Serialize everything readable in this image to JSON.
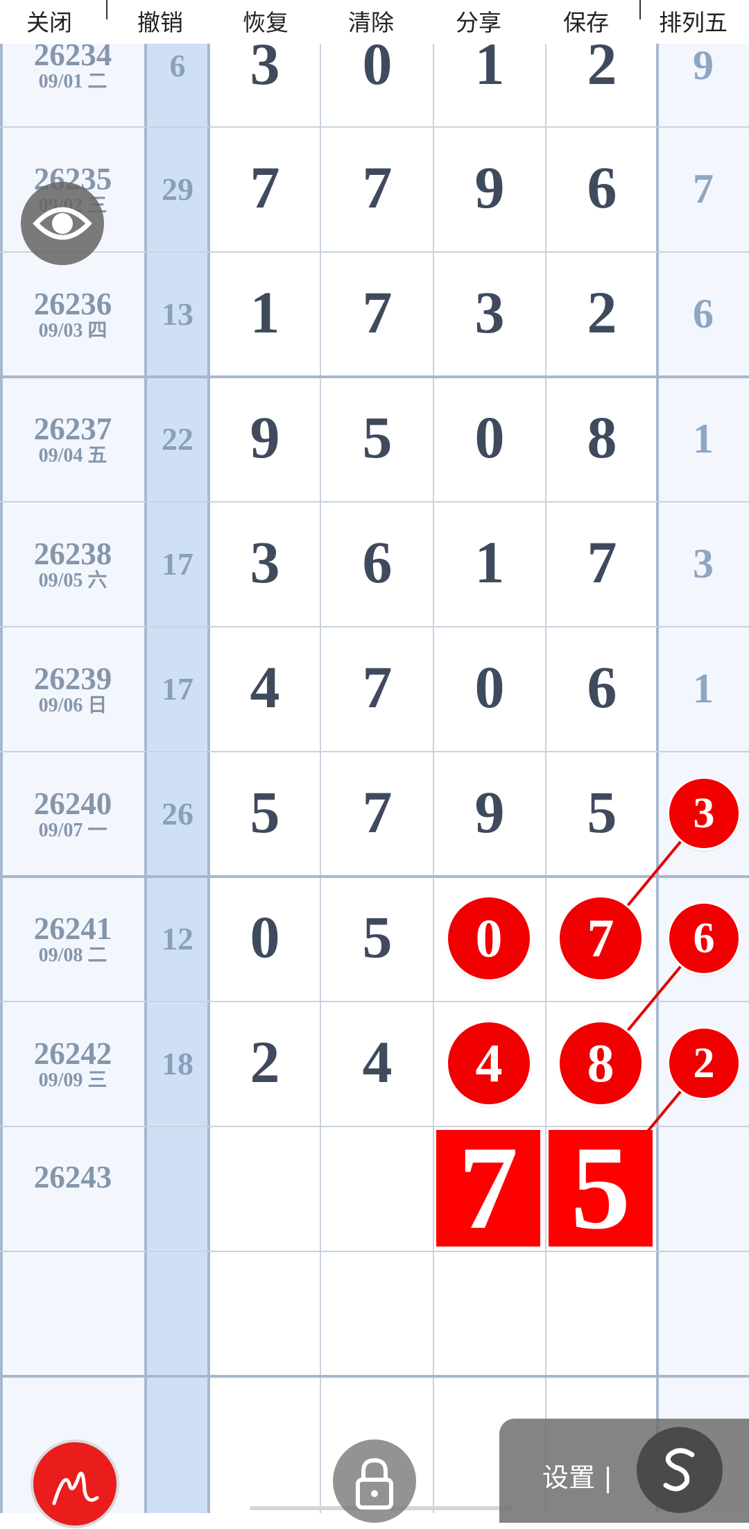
{
  "toolbar": {
    "close": "关闭",
    "undo": "撤销",
    "redo": "恢复",
    "clear": "清除",
    "share": "分享",
    "save": "保存",
    "lottery_type": "排列五"
  },
  "rows": [
    {
      "issue": "26234",
      "date": "09/01 二",
      "sum": "6",
      "d1": "3",
      "d2": "0",
      "d3": "1",
      "d4": "2",
      "d5": "9"
    },
    {
      "issue": "26235",
      "date": "09/02 三",
      "sum": "29",
      "d1": "7",
      "d2": "7",
      "d3": "9",
      "d4": "6",
      "d5": "7"
    },
    {
      "issue": "26236",
      "date": "09/03 四",
      "sum": "13",
      "d1": "1",
      "d2": "7",
      "d3": "3",
      "d4": "2",
      "d5": "6"
    },
    {
      "issue": "26237",
      "date": "09/04 五",
      "sum": "22",
      "d1": "9",
      "d2": "5",
      "d3": "0",
      "d4": "8",
      "d5": "1"
    },
    {
      "issue": "26238",
      "date": "09/05 六",
      "sum": "17",
      "d1": "3",
      "d2": "6",
      "d3": "1",
      "d4": "7",
      "d5": "3"
    },
    {
      "issue": "26239",
      "date": "09/06 日",
      "sum": "17",
      "d1": "4",
      "d2": "7",
      "d3": "0",
      "d4": "6",
      "d5": "1"
    },
    {
      "issue": "26240",
      "date": "09/07 一",
      "sum": "26",
      "d1": "5",
      "d2": "7",
      "d3": "9",
      "d4": "5",
      "d5": "3"
    },
    {
      "issue": "26241",
      "date": "09/08 二",
      "sum": "12",
      "d1": "0",
      "d2": "5",
      "d3": "0",
      "d4": "7",
      "d5": "6"
    },
    {
      "issue": "26242",
      "date": "09/09 三",
      "sum": "18",
      "d1": "2",
      "d2": "4",
      "d3": "4",
      "d4": "8",
      "d5": "2"
    },
    {
      "issue": "26243",
      "date": "",
      "sum": "",
      "d1": "",
      "d2": "",
      "d3": "7",
      "d4": "5",
      "d5": ""
    }
  ],
  "settings": {
    "label": "设置 |"
  },
  "colors": {
    "accent_red": "#ff0000",
    "grid_blue": "#cfe0f6",
    "digit": "#3f4a5d"
  },
  "icons": {
    "eye": "eye-icon",
    "sign": "signature-icon",
    "lock": "lock-icon",
    "settings": "s-logo-icon"
  }
}
